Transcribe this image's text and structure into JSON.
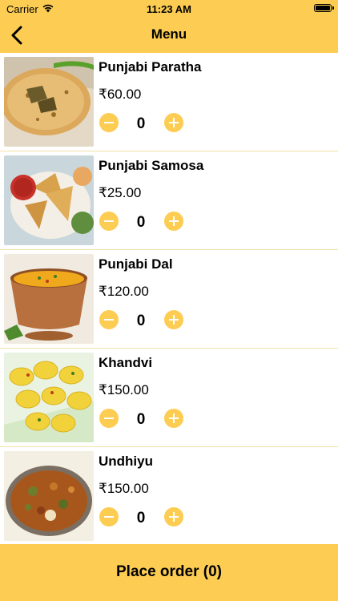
{
  "status_bar": {
    "carrier": "Carrier",
    "time": "11:23 AM"
  },
  "nav": {
    "title": "Menu",
    "back_icon": "chevron-left-icon"
  },
  "theme": {
    "accent": "#fccd52"
  },
  "menu": {
    "items": [
      {
        "name": "Punjabi Paratha",
        "price": "₹60.00",
        "quantity": "0"
      },
      {
        "name": "Punjabi Samosa",
        "price": "₹25.00",
        "quantity": "0"
      },
      {
        "name": "Punjabi Dal",
        "price": "₹120.00",
        "quantity": "0"
      },
      {
        "name": "Khandvi",
        "price": "₹150.00",
        "quantity": "0"
      },
      {
        "name": "Undhiyu",
        "price": "₹150.00",
        "quantity": "0"
      }
    ]
  },
  "footer": {
    "place_order_label": "Place order (0)"
  }
}
